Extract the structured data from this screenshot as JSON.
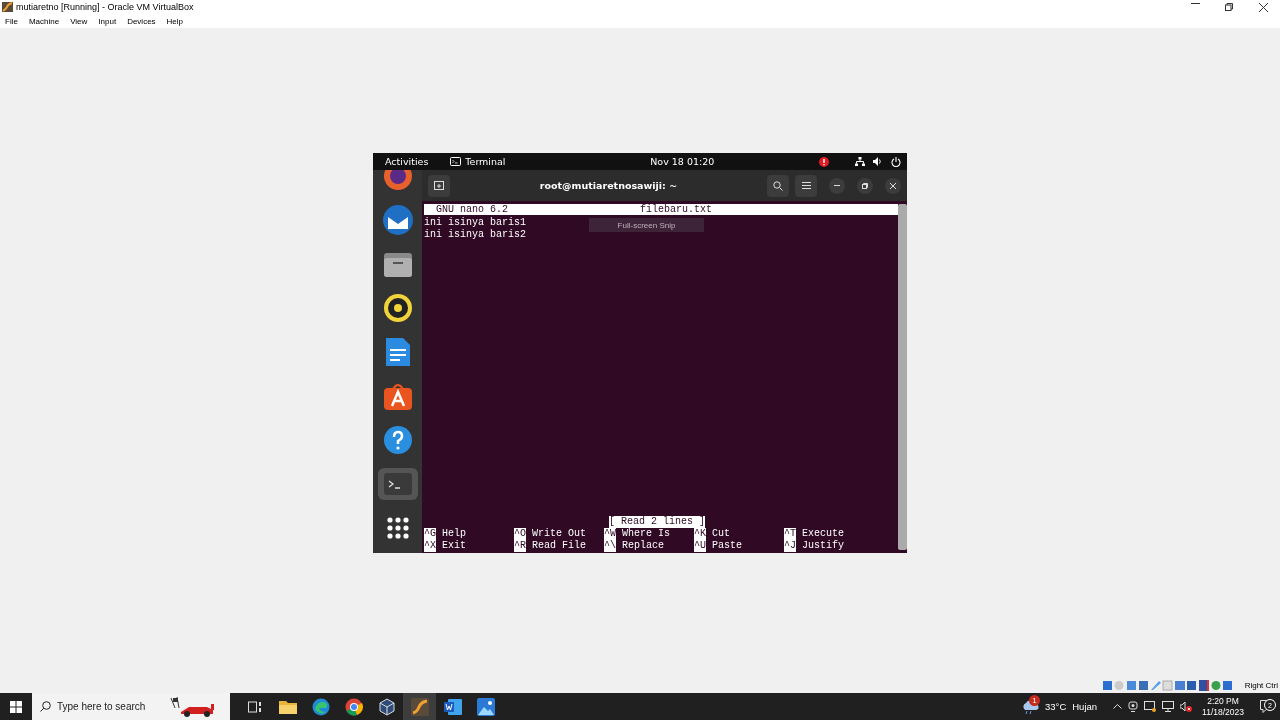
{
  "window": {
    "title": "mutiaretno [Running] - Oracle VM VirtualBox"
  },
  "menu": [
    "File",
    "Machine",
    "View",
    "Input",
    "Devices",
    "Help"
  ],
  "guest": {
    "top_bar": {
      "activities": "Activities",
      "app": "Terminal",
      "clock": "Nov 18  01:20"
    },
    "dock": [
      {
        "kind": "browser",
        "selected": false
      },
      {
        "kind": "mail",
        "selected": false
      },
      {
        "kind": "files",
        "selected": false
      },
      {
        "kind": "music",
        "selected": false
      },
      {
        "kind": "document",
        "selected": false
      },
      {
        "kind": "store",
        "selected": false
      },
      {
        "kind": "help",
        "selected": false
      },
      {
        "kind": "terminal",
        "selected": true
      },
      {
        "kind": "apps",
        "selected": false
      }
    ],
    "terminal": {
      "title": "root@mutiaretnosawiji: ~",
      "nano": {
        "version": "GNU nano 6.2",
        "filename": "filebaru.txt",
        "lines": [
          "ini isinya baris1",
          "ini isinya baris2"
        ],
        "status": "[ Read 2 lines ]",
        "shortcuts": [
          [
            {
              "key": "^G",
              "label": "Help"
            },
            {
              "key": "^O",
              "label": "Write Out"
            },
            {
              "key": "^W",
              "label": "Where Is"
            },
            {
              "key": "^K",
              "label": "Cut"
            },
            {
              "key": "^T",
              "label": "Execute"
            }
          ],
          [
            {
              "key": "^X",
              "label": "Exit"
            },
            {
              "key": "^R",
              "label": "Read File"
            },
            {
              "key": "^\\",
              "label": "Replace"
            },
            {
              "key": "^U",
              "label": "Paste"
            },
            {
              "key": "^J",
              "label": "Justify"
            }
          ]
        ]
      }
    },
    "tooltip": "Full-screen Snip"
  },
  "vm_status": {
    "host_key": "Right Ctrl"
  },
  "taskbar": {
    "search": {
      "placeholder": "Type here to search"
    },
    "apps": [
      {
        "kind": "task-view",
        "selected": false
      },
      {
        "kind": "folder",
        "selected": false
      },
      {
        "kind": "edge",
        "selected": false
      },
      {
        "kind": "chrome",
        "selected": false
      },
      {
        "kind": "cube",
        "selected": false
      },
      {
        "kind": "vm",
        "selected": true
      },
      {
        "kind": "word",
        "selected": false
      },
      {
        "kind": "photos",
        "selected": false
      }
    ],
    "weather": {
      "badge": "1",
      "temperature": "33°C",
      "condition": "Hujan"
    },
    "time": "2:20 PM",
    "date": "11/18/2023",
    "notifications": "2"
  }
}
